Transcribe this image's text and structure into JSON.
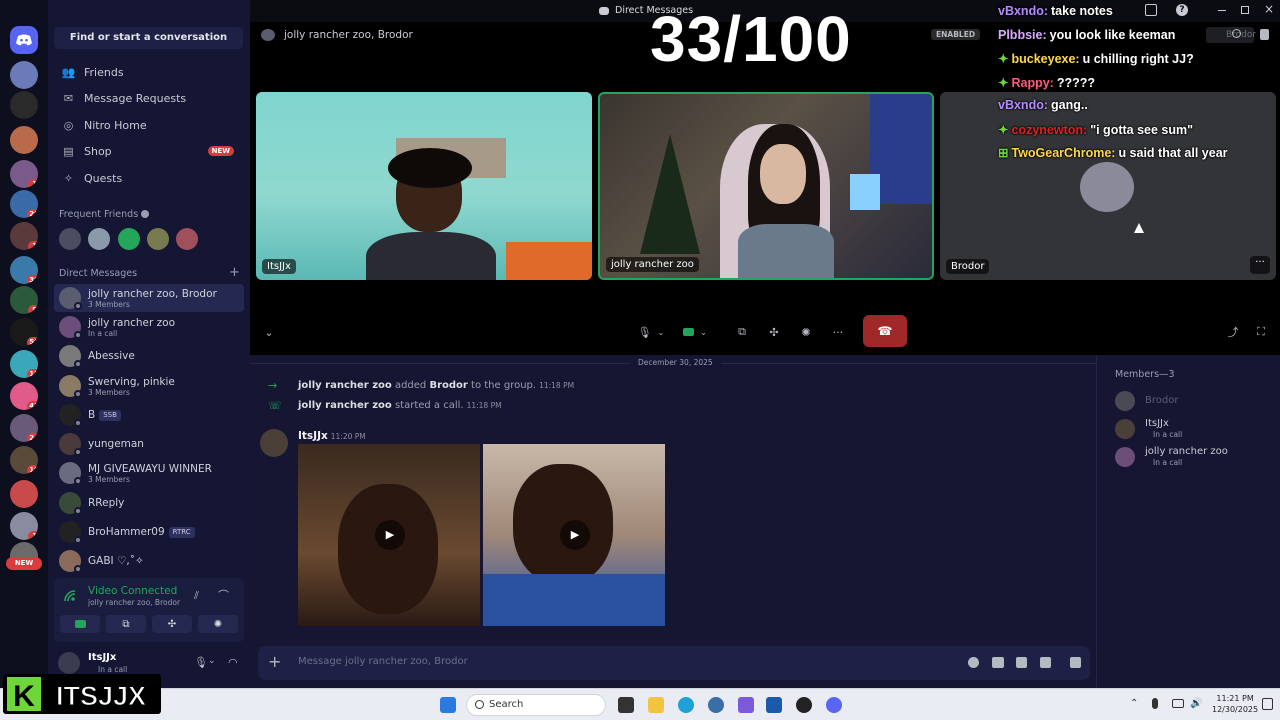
{
  "window": {
    "title": "Direct Messages"
  },
  "overlay": {
    "count": "33/100",
    "chat": [
      {
        "user": "vBxndo:",
        "text": "take notes",
        "color": "#b48cff",
        "badge": ""
      },
      {
        "user": "Plbbsie:",
        "text": "you look like keeman",
        "color": "#d9a8ff",
        "badge": ""
      },
      {
        "user": "buckeyexe:",
        "text": "u chilling right JJ?",
        "color": "#ffd84a",
        "badge": "✦"
      },
      {
        "user": "Rappy:",
        "text": "?????",
        "color": "#ff5a7a",
        "badge": "✦"
      },
      {
        "user": "vBxndo:",
        "text": "gang..",
        "color": "#b48cff",
        "badge": ""
      },
      {
        "user": "cozynewton:",
        "text": "\"i gotta see sum\"",
        "color": "#e02020",
        "badge": "✦"
      },
      {
        "user": "TwoGearChrome:",
        "text": "u said that all year",
        "color": "#ffd84a",
        "badge": "⊞"
      }
    ],
    "logo_text": "ITSJJX"
  },
  "sidebar": {
    "search_placeholder": "Find or start a conversation",
    "nav": [
      {
        "label": "Friends",
        "icon": "friends-icon",
        "tag": ""
      },
      {
        "label": "Message Requests",
        "icon": "mail-icon",
        "tag": ""
      },
      {
        "label": "Nitro Home",
        "icon": "nitro-icon",
        "tag": ""
      },
      {
        "label": "Shop",
        "icon": "shop-icon",
        "tag": "NEW"
      },
      {
        "label": "Quests",
        "icon": "quests-icon",
        "tag": ""
      }
    ],
    "frequent_friends_title": "Frequent Friends",
    "direct_messages_title": "Direct Messages",
    "dms": [
      {
        "name": "jolly rancher zoo, Brodor",
        "sub": "3 Members",
        "tag": "",
        "color": "#5a5d70",
        "active": true
      },
      {
        "name": "jolly rancher zoo",
        "sub": "In a call",
        "tag": "",
        "color": "#6b4e7a",
        "active": false
      },
      {
        "name": "Abessive",
        "sub": "",
        "tag": "",
        "color": "#7a7a7a",
        "active": false
      },
      {
        "name": "Swerving, pinkie",
        "sub": "3 Members",
        "tag": "",
        "color": "#8a7a66",
        "active": false
      },
      {
        "name": "B",
        "sub": "",
        "tag": "SSB",
        "color": "#222",
        "active": false
      },
      {
        "name": "yungeman",
        "sub": "",
        "tag": "",
        "color": "#4a3a3a",
        "active": false
      },
      {
        "name": "MJ GIVEAWAYU WINNER",
        "sub": "3 Members",
        "tag": "",
        "color": "#6a6a80",
        "active": false
      },
      {
        "name": "RReply",
        "sub": "",
        "tag": "",
        "color": "#3a4a3a",
        "active": false
      },
      {
        "name": "BroHammer09",
        "sub": "",
        "tag": "RTRC",
        "color": "#222",
        "active": false
      },
      {
        "name": "GABI ♡,˚✧",
        "sub": "",
        "tag": "",
        "color": "#8a6a5a",
        "active": false
      }
    ],
    "voice": {
      "status": "Video Connected",
      "channel": "jolly rancher zoo, Brodor"
    },
    "user": {
      "name": "ItsJJx",
      "status": "In a call"
    }
  },
  "rail": {
    "badges": [
      "1",
      "28",
      "1",
      "30",
      "5",
      "50",
      "12",
      "43",
      "24",
      "19",
      "1",
      "1"
    ],
    "new_label": "NEW"
  },
  "call": {
    "header_title": "jolly rancher zoo, Brodor",
    "enabled_label": "ENABLED",
    "header_search": "Brodor",
    "tiles": [
      {
        "label": "ItsJJx"
      },
      {
        "label": "jolly rancher zoo"
      },
      {
        "label": "Brodor"
      }
    ]
  },
  "chat": {
    "date_divider": "December 30, 2025",
    "system": [
      {
        "actor": "jolly rancher zoo",
        "text": "added",
        "target": "Brodor",
        "tail": "to the group.",
        "time": "11:18 PM"
      },
      {
        "actor": "jolly rancher zoo",
        "text": "started a call.",
        "target": "",
        "tail": "",
        "time": "11:18 PM"
      }
    ],
    "message": {
      "author": "ItsJJx",
      "time": "11:20 PM"
    },
    "composer_placeholder": "Message jolly rancher zoo, Brodor"
  },
  "members": {
    "title": "Members—3",
    "list": [
      {
        "name": "Brodor",
        "status": "",
        "dim": true
      },
      {
        "name": "ItsJJx",
        "status": "In a call",
        "dim": false
      },
      {
        "name": "jolly rancher zoo",
        "status": "In a call",
        "dim": false
      }
    ]
  },
  "taskbar": {
    "search_label": "Search",
    "time": "11:21 PM",
    "date": "12/30/2025"
  }
}
